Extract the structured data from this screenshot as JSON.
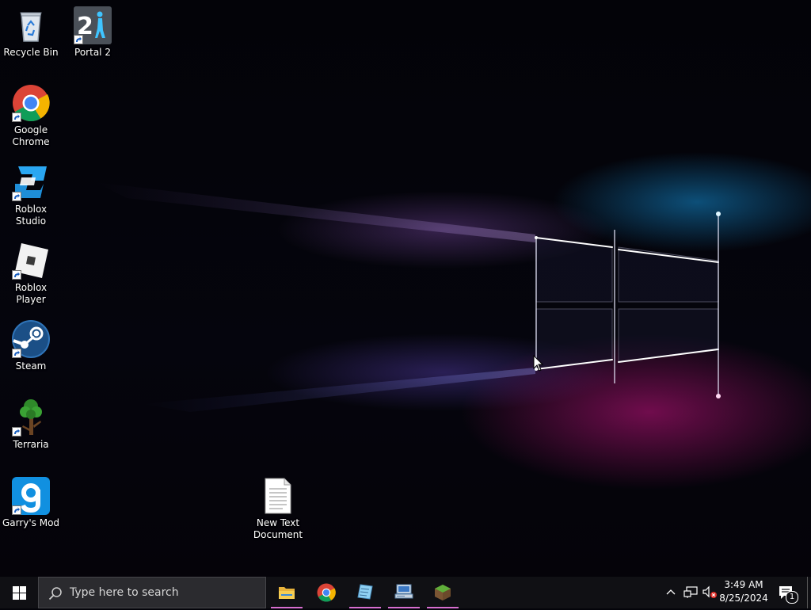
{
  "desktop": {
    "icons": [
      {
        "label": "Recycle Bin",
        "icon": "recycle-bin-icon"
      },
      {
        "label": "Portal 2",
        "icon": "portal-2-icon"
      },
      {
        "label": "Google Chrome",
        "icon": "chrome-icon"
      },
      {
        "label": "Roblox Studio",
        "icon": "roblox-studio-icon"
      },
      {
        "label": "Roblox Player",
        "icon": "roblox-player-icon"
      },
      {
        "label": "Steam",
        "icon": "steam-icon"
      },
      {
        "label": "Terraria",
        "icon": "terraria-icon"
      },
      {
        "label": "Garry's Mod",
        "icon": "garrys-mod-icon"
      },
      {
        "label": "New Text Document",
        "icon": "text-document-icon"
      }
    ],
    "portal_number": "2"
  },
  "taskbar": {
    "search_placeholder": "Type here to search",
    "pinned": [
      "file-explorer-icon",
      "chrome-icon",
      "notepad-icon",
      "network-computer-icon",
      "minecraft-icon"
    ],
    "tray": {
      "time": "3:49 AM",
      "date": "8/25/2024",
      "notification_count": "1"
    }
  },
  "colors": {
    "taskbar": "#101014",
    "search_box": "#2b2b2f",
    "running_underline": "#d86ed0"
  }
}
